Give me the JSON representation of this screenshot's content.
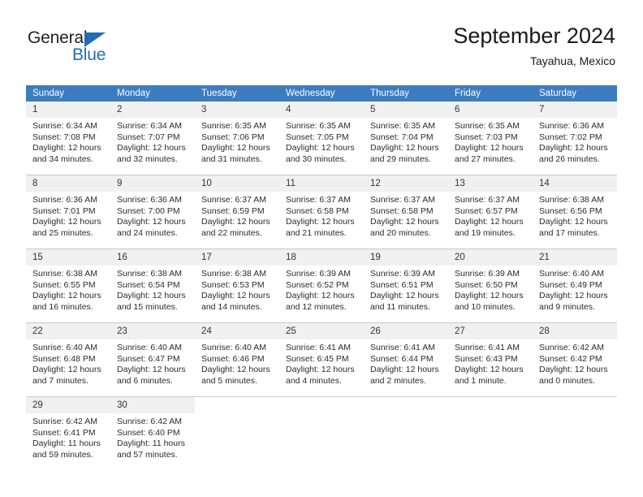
{
  "brand": {
    "name_part1": "General",
    "name_part2": "Blue",
    "accent_color": "#1f6fb4"
  },
  "header": {
    "title": "September 2024",
    "subtitle": "Tayahua, Mexico"
  },
  "calendar": {
    "header_color": "#3c7cbf",
    "daynum_band_color": "#f0f0f0",
    "weekday_headers": [
      "Sunday",
      "Monday",
      "Tuesday",
      "Wednesday",
      "Thursday",
      "Friday",
      "Saturday"
    ],
    "weeks": [
      [
        {
          "day": "1",
          "sunrise": "Sunrise: 6:34 AM",
          "sunset": "Sunset: 7:08 PM",
          "daylight": "Daylight: 12 hours and 34 minutes."
        },
        {
          "day": "2",
          "sunrise": "Sunrise: 6:34 AM",
          "sunset": "Sunset: 7:07 PM",
          "daylight": "Daylight: 12 hours and 32 minutes."
        },
        {
          "day": "3",
          "sunrise": "Sunrise: 6:35 AM",
          "sunset": "Sunset: 7:06 PM",
          "daylight": "Daylight: 12 hours and 31 minutes."
        },
        {
          "day": "4",
          "sunrise": "Sunrise: 6:35 AM",
          "sunset": "Sunset: 7:05 PM",
          "daylight": "Daylight: 12 hours and 30 minutes."
        },
        {
          "day": "5",
          "sunrise": "Sunrise: 6:35 AM",
          "sunset": "Sunset: 7:04 PM",
          "daylight": "Daylight: 12 hours and 29 minutes."
        },
        {
          "day": "6",
          "sunrise": "Sunrise: 6:35 AM",
          "sunset": "Sunset: 7:03 PM",
          "daylight": "Daylight: 12 hours and 27 minutes."
        },
        {
          "day": "7",
          "sunrise": "Sunrise: 6:36 AM",
          "sunset": "Sunset: 7:02 PM",
          "daylight": "Daylight: 12 hours and 26 minutes."
        }
      ],
      [
        {
          "day": "8",
          "sunrise": "Sunrise: 6:36 AM",
          "sunset": "Sunset: 7:01 PM",
          "daylight": "Daylight: 12 hours and 25 minutes."
        },
        {
          "day": "9",
          "sunrise": "Sunrise: 6:36 AM",
          "sunset": "Sunset: 7:00 PM",
          "daylight": "Daylight: 12 hours and 24 minutes."
        },
        {
          "day": "10",
          "sunrise": "Sunrise: 6:37 AM",
          "sunset": "Sunset: 6:59 PM",
          "daylight": "Daylight: 12 hours and 22 minutes."
        },
        {
          "day": "11",
          "sunrise": "Sunrise: 6:37 AM",
          "sunset": "Sunset: 6:58 PM",
          "daylight": "Daylight: 12 hours and 21 minutes."
        },
        {
          "day": "12",
          "sunrise": "Sunrise: 6:37 AM",
          "sunset": "Sunset: 6:58 PM",
          "daylight": "Daylight: 12 hours and 20 minutes."
        },
        {
          "day": "13",
          "sunrise": "Sunrise: 6:37 AM",
          "sunset": "Sunset: 6:57 PM",
          "daylight": "Daylight: 12 hours and 19 minutes."
        },
        {
          "day": "14",
          "sunrise": "Sunrise: 6:38 AM",
          "sunset": "Sunset: 6:56 PM",
          "daylight": "Daylight: 12 hours and 17 minutes."
        }
      ],
      [
        {
          "day": "15",
          "sunrise": "Sunrise: 6:38 AM",
          "sunset": "Sunset: 6:55 PM",
          "daylight": "Daylight: 12 hours and 16 minutes."
        },
        {
          "day": "16",
          "sunrise": "Sunrise: 6:38 AM",
          "sunset": "Sunset: 6:54 PM",
          "daylight": "Daylight: 12 hours and 15 minutes."
        },
        {
          "day": "17",
          "sunrise": "Sunrise: 6:38 AM",
          "sunset": "Sunset: 6:53 PM",
          "daylight": "Daylight: 12 hours and 14 minutes."
        },
        {
          "day": "18",
          "sunrise": "Sunrise: 6:39 AM",
          "sunset": "Sunset: 6:52 PM",
          "daylight": "Daylight: 12 hours and 12 minutes."
        },
        {
          "day": "19",
          "sunrise": "Sunrise: 6:39 AM",
          "sunset": "Sunset: 6:51 PM",
          "daylight": "Daylight: 12 hours and 11 minutes."
        },
        {
          "day": "20",
          "sunrise": "Sunrise: 6:39 AM",
          "sunset": "Sunset: 6:50 PM",
          "daylight": "Daylight: 12 hours and 10 minutes."
        },
        {
          "day": "21",
          "sunrise": "Sunrise: 6:40 AM",
          "sunset": "Sunset: 6:49 PM",
          "daylight": "Daylight: 12 hours and 9 minutes."
        }
      ],
      [
        {
          "day": "22",
          "sunrise": "Sunrise: 6:40 AM",
          "sunset": "Sunset: 6:48 PM",
          "daylight": "Daylight: 12 hours and 7 minutes."
        },
        {
          "day": "23",
          "sunrise": "Sunrise: 6:40 AM",
          "sunset": "Sunset: 6:47 PM",
          "daylight": "Daylight: 12 hours and 6 minutes."
        },
        {
          "day": "24",
          "sunrise": "Sunrise: 6:40 AM",
          "sunset": "Sunset: 6:46 PM",
          "daylight": "Daylight: 12 hours and 5 minutes."
        },
        {
          "day": "25",
          "sunrise": "Sunrise: 6:41 AM",
          "sunset": "Sunset: 6:45 PM",
          "daylight": "Daylight: 12 hours and 4 minutes."
        },
        {
          "day": "26",
          "sunrise": "Sunrise: 6:41 AM",
          "sunset": "Sunset: 6:44 PM",
          "daylight": "Daylight: 12 hours and 2 minutes."
        },
        {
          "day": "27",
          "sunrise": "Sunrise: 6:41 AM",
          "sunset": "Sunset: 6:43 PM",
          "daylight": "Daylight: 12 hours and 1 minute."
        },
        {
          "day": "28",
          "sunrise": "Sunrise: 6:42 AM",
          "sunset": "Sunset: 6:42 PM",
          "daylight": "Daylight: 12 hours and 0 minutes."
        }
      ],
      [
        {
          "day": "29",
          "sunrise": "Sunrise: 6:42 AM",
          "sunset": "Sunset: 6:41 PM",
          "daylight": "Daylight: 11 hours and 59 minutes."
        },
        {
          "day": "30",
          "sunrise": "Sunrise: 6:42 AM",
          "sunset": "Sunset: 6:40 PM",
          "daylight": "Daylight: 11 hours and 57 minutes."
        },
        null,
        null,
        null,
        null,
        null
      ]
    ]
  }
}
